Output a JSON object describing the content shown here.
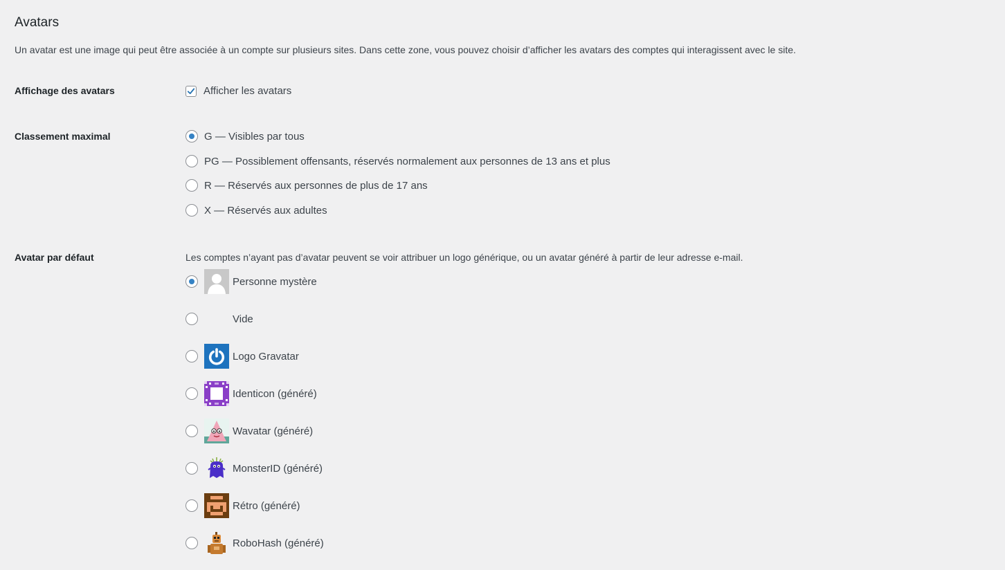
{
  "section": {
    "title": "Avatars",
    "description": "Un avatar est une image qui peut être associée à un compte sur plusieurs sites. Dans cette zone, vous pouvez choisir d’afficher les avatars des comptes qui interagissent avec le site."
  },
  "display": {
    "label": "Affichage des avatars",
    "checkbox_label": "Afficher les avatars",
    "checked": true
  },
  "rating": {
    "label": "Classement maximal",
    "options": [
      {
        "label": "G — Visibles par tous",
        "checked": true
      },
      {
        "label": "PG — Possiblement offensants, réservés normalement aux personnes de 13 ans et plus",
        "checked": false
      },
      {
        "label": "R — Réservés aux personnes de plus de 17 ans",
        "checked": false
      },
      {
        "label": "X — Réservés aux adultes",
        "checked": false
      }
    ]
  },
  "default_avatar": {
    "label": "Avatar par défaut",
    "description": "Les comptes n’ayant pas d’avatar peuvent se voir attribuer un logo générique, ou un avatar généré à partir de leur adresse e-mail.",
    "options": [
      {
        "label": "Personne mystère",
        "icon": "mystery-person-icon",
        "checked": true
      },
      {
        "label": "Vide",
        "icon": "blank-icon",
        "checked": false
      },
      {
        "label": "Logo Gravatar",
        "icon": "gravatar-logo-icon",
        "checked": false
      },
      {
        "label": "Identicon (généré)",
        "icon": "identicon-icon",
        "checked": false
      },
      {
        "label": "Wavatar (généré)",
        "icon": "wavatar-icon",
        "checked": false
      },
      {
        "label": "MonsterID (généré)",
        "icon": "monsterid-icon",
        "checked": false
      },
      {
        "label": "Rétro (généré)",
        "icon": "retro-icon",
        "checked": false
      },
      {
        "label": "RoboHash (généré)",
        "icon": "robohash-icon",
        "checked": false
      }
    ]
  },
  "colors": {
    "background": "#f0f0f1",
    "accent": "#3582c4",
    "text": "#1d2327",
    "muted_text": "#3c434a"
  }
}
